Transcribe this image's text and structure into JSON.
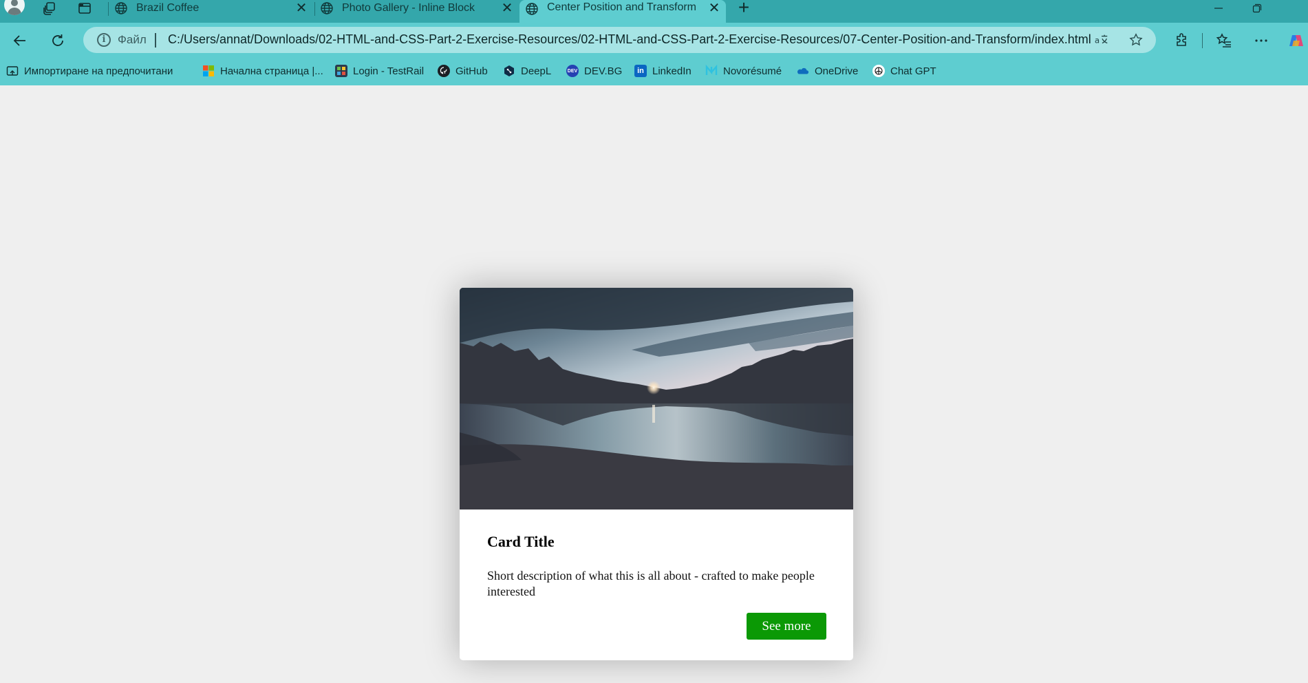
{
  "browser": {
    "tabs": [
      {
        "label": "Brazil Coffee",
        "active": false
      },
      {
        "label": "Photo Gallery - Inline Block",
        "active": false
      },
      {
        "label": "Center Position and Transform",
        "active": true
      }
    ],
    "tab_close_glyph": "✕",
    "new_tab_glyph": "+",
    "address": {
      "scheme_label": "Файл",
      "url": "C:/Users/annat/Downloads/02-HTML-and-CSS-Part-2-Exercise-Resources/02-HTML-and-CSS-Part-2-Exercise-Resources/07-Center-Position-and-Transform/index.html"
    },
    "bookmarks": [
      {
        "label": "Импортиране на предпочитани",
        "icon": "import-favorites-icon"
      },
      {
        "label": "Начална страница |...",
        "icon": "microsoft-icon"
      },
      {
        "label": "Login - TestRail",
        "icon": "testrail-icon"
      },
      {
        "label": "GitHub",
        "icon": "github-icon"
      },
      {
        "label": "DeepL",
        "icon": "deepl-icon"
      },
      {
        "label": "DEV.BG",
        "icon": "devbg-icon"
      },
      {
        "label": "LinkedIn",
        "icon": "linkedin-icon"
      },
      {
        "label": "Novorésumé",
        "icon": "novoresume-icon"
      },
      {
        "label": "OneDrive",
        "icon": "onedrive-icon"
      },
      {
        "label": "Chat GPT",
        "icon": "chatgpt-icon"
      }
    ],
    "colors": {
      "tabstrip": "#34a7ab",
      "toolbar": "#5ecdd0",
      "omnibox": "#a6e4e5"
    }
  },
  "card": {
    "title": "Card Title",
    "description": "Short description of what this is all about - crafted to make people interested",
    "button_label": "See more",
    "image_icon": "lake-sunset-photo",
    "colors": {
      "button": "#0b9905",
      "page_bg": "#efefef"
    }
  }
}
